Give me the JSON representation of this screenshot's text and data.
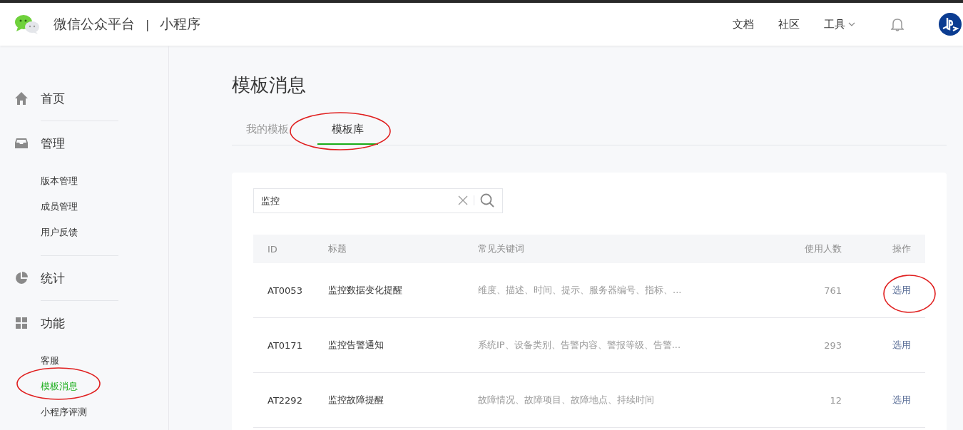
{
  "header": {
    "brand": "微信公众平台",
    "separator": "|",
    "product": "小程序",
    "nav": [
      {
        "label": "文档",
        "kind": "link"
      },
      {
        "label": "社区",
        "kind": "link"
      },
      {
        "label": "工具",
        "kind": "dropdown"
      }
    ]
  },
  "sidebar": {
    "sections": [
      {
        "label": "首页",
        "kind": "home"
      },
      {
        "label": "管理",
        "kind": "inbox",
        "children": [
          {
            "label": "版本管理",
            "selected": false
          },
          {
            "label": "成员管理",
            "selected": false
          },
          {
            "label": "用户反馈",
            "selected": false
          }
        ]
      },
      {
        "label": "统计",
        "kind": "pie"
      },
      {
        "label": "功能",
        "kind": "grid",
        "children": [
          {
            "label": "客服",
            "selected": false
          },
          {
            "label": "模板消息",
            "selected": true
          },
          {
            "label": "小程序评测",
            "selected": false
          }
        ]
      }
    ]
  },
  "page_title": "模板消息",
  "tabs": [
    {
      "label": "我的模板",
      "selected": false
    },
    {
      "label": "模板库",
      "selected": true
    }
  ],
  "search": {
    "value": "监控"
  },
  "table": {
    "columns": [
      "ID",
      "标题",
      "常见关键词",
      "使用人数",
      "操作"
    ],
    "rows": [
      {
        "id": "AT0053",
        "title": "监控数据变化提醒",
        "keywords": "维度、描述、时间、提示、服务器编号、指标、...",
        "count": "761",
        "action": "选用"
      },
      {
        "id": "AT0171",
        "title": "监控告警通知",
        "keywords": "系统IP、设备类别、告警内容、警报等级、告警...",
        "count": "293",
        "action": "选用"
      },
      {
        "id": "AT2292",
        "title": "监控故障提醒",
        "keywords": "故障情况、故障项目、故障地点、持续时间",
        "count": "12",
        "action": "选用"
      }
    ]
  }
}
